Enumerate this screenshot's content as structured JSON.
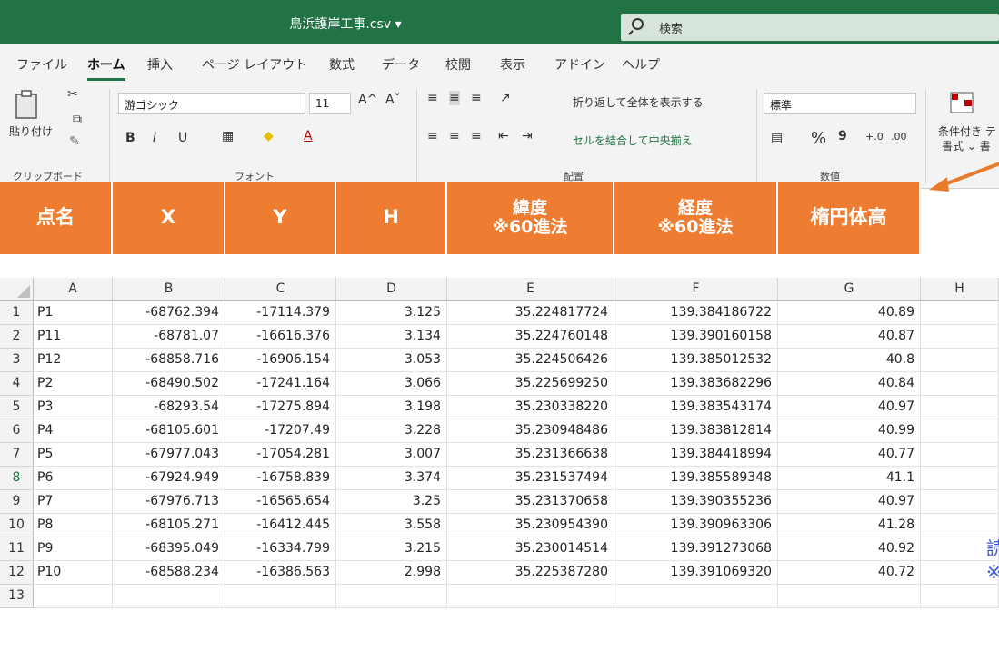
{
  "title_bar": {
    "filename": "鳥浜護岸工事.csv ▾",
    "search_label": "検索"
  },
  "menu": [
    "ファイル",
    "ホーム",
    "挿入",
    "ページ レイアウト",
    "数式",
    "データ",
    "校閲",
    "表示",
    "アドイン",
    "ヘルプ"
  ],
  "ribbon": {
    "paste_label": "貼り付け",
    "font_name": "游ゴシック",
    "font_size": "11",
    "font_grow": "A^",
    "font_shrink": "Aˇ",
    "bold": "B",
    "italic": "I",
    "underline": "U",
    "wrap_text": "折り返して全体を表示する",
    "merge_center": "セルを結合して中央揃え",
    "number_format": "標準",
    "percent": "%",
    "comma": "9",
    "conditional_format": "条件付き テ",
    "conditional_format_2": "書式 ⌄ 書",
    "groups": [
      "クリップボード",
      "フォント",
      "配置",
      "数値"
    ]
  },
  "header_band": [
    "点名",
    "X",
    "Y",
    "H",
    "緯度\n※60進法",
    "経度\n※60進法",
    "楕円体高"
  ],
  "grid": {
    "columns": [
      "A",
      "B",
      "C",
      "D",
      "E",
      "F",
      "G",
      "H"
    ],
    "rows": [
      [
        "P1",
        "-68762.394",
        "-17114.379",
        "3.125",
        "35.224817724",
        "139.384186722",
        "40.89"
      ],
      [
        "P11",
        "-68781.07",
        "-16616.376",
        "3.134",
        "35.224760148",
        "139.390160158",
        "40.87"
      ],
      [
        "P12",
        "-68858.716",
        "-16906.154",
        "3.053",
        "35.224506426",
        "139.385012532",
        "40.8"
      ],
      [
        "P2",
        "-68490.502",
        "-17241.164",
        "3.066",
        "35.225699250",
        "139.383682296",
        "40.84"
      ],
      [
        "P3",
        "-68293.54",
        "-17275.894",
        "3.198",
        "35.230338220",
        "139.383543174",
        "40.97"
      ],
      [
        "P4",
        "-68105.601",
        "-17207.49",
        "3.228",
        "35.230948486",
        "139.383812814",
        "40.99"
      ],
      [
        "P5",
        "-67977.043",
        "-17054.281",
        "3.007",
        "35.231366638",
        "139.384418994",
        "40.77"
      ],
      [
        "P6",
        "-67924.949",
        "-16758.839",
        "3.374",
        "35.231537494",
        "139.385589348",
        "41.1"
      ],
      [
        "P7",
        "-67976.713",
        "-16565.654",
        "3.25",
        "35.231370658",
        "139.390355236",
        "40.97"
      ],
      [
        "P8",
        "-68105.271",
        "-16412.445",
        "3.558",
        "35.230954390",
        "139.390963306",
        "41.28"
      ],
      [
        "P9",
        "-68395.049",
        "-16334.799",
        "3.215",
        "35.230014514",
        "139.391273068",
        "40.92"
      ],
      [
        "P10",
        "-68588.234",
        "-16386.563",
        "2.998",
        "35.225387280",
        "139.391069320",
        "40.72"
      ]
    ],
    "row_numbers": [
      "1",
      "2",
      "3",
      "4",
      "5",
      "6",
      "7",
      "8",
      "9",
      "10",
      "11",
      "12",
      "13"
    ],
    "selected_row": "8"
  },
  "side_note": [
    "読",
    "※"
  ],
  "colors": {
    "excel_green": "#217346",
    "band_orange": "#ef7d31",
    "note_blue": "#3a5bd9",
    "arrow_orange": "#e87b2c"
  }
}
